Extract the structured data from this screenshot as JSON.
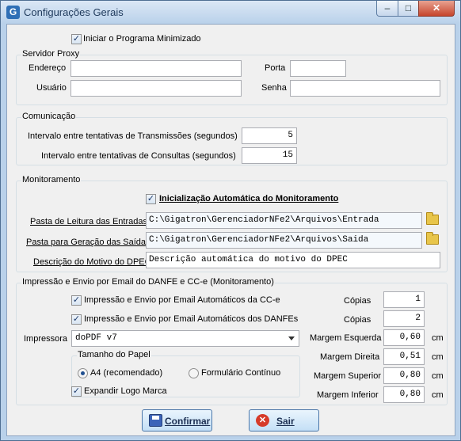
{
  "window": {
    "title": "Configurações Gerais",
    "icon": "G"
  },
  "general": {
    "start_minimized_label": "Iniciar o Programa Minimizado",
    "start_minimized_checked": true
  },
  "proxy": {
    "group_title": "Servidor Proxy",
    "address_label": "Endereço",
    "address_value": "",
    "port_label": "Porta",
    "port_value": "",
    "user_label": "Usuário",
    "user_value": "",
    "password_label": "Senha",
    "password_value": ""
  },
  "communication": {
    "group_title": "Comunicação",
    "transmission_label": "Intervalo entre tentativas de Transmissões (segundos)",
    "transmission_value": "5",
    "query_label": "Intervalo entre tentativas de Consultas (segundos)",
    "query_value": "15"
  },
  "monitoring": {
    "group_title": "Monitoramento",
    "auto_init_label": "Inicialização Automática do Monitoramento",
    "auto_init_checked": true,
    "input_folder_label": "Pasta de Leitura das Entradas",
    "input_folder_value": "C:\\Gigatron\\GerenciadorNFe2\\Arquivos\\Entrada",
    "output_folder_label": "Pasta para Geração das Saídas",
    "output_folder_value": "C:\\Gigatron\\GerenciadorNFe2\\Arquivos\\Saida",
    "dpec_label": "Descrição do Motivo do DPEC",
    "dpec_value": "Descrição automática do motivo do DPEC"
  },
  "print": {
    "group_title": "Impressão e Envio por Email do DANFE e CC-e (Monitoramento)",
    "cce_label": "Impressão e Envio por Email Automáticos da CC-e",
    "cce_checked": true,
    "danfe_label": "Impressão e Envio por Email Automáticos dos DANFEs",
    "danfe_checked": true,
    "printer_label": "Impressora",
    "printer_value": "doPDF v7",
    "paper_group_title": "Tamanho do Papel",
    "paper_a4_label": "A4 (recomendado)",
    "paper_continuous_label": "Formulário Contínuo",
    "paper_selected": "A4 (recomendado)",
    "expand_logo_label": "Expandir Logo Marca",
    "expand_logo_checked": true,
    "copies_label_1": "Cópias",
    "copies_value_1": "1",
    "copies_label_2": "Cópias",
    "copies_value_2": "2",
    "margin_left_label": "Margem Esquerda",
    "margin_left_value": "0,60",
    "margin_right_label": "Margem Direita",
    "margin_right_value": "0,51",
    "margin_top_label": "Margem Superior",
    "margin_top_value": "0,80",
    "margin_bottom_label": "Margem Inferior",
    "margin_bottom_value": "0,80",
    "unit": "cm"
  },
  "buttons": {
    "confirm_label": "Confirmar",
    "exit_label": "Sair"
  }
}
